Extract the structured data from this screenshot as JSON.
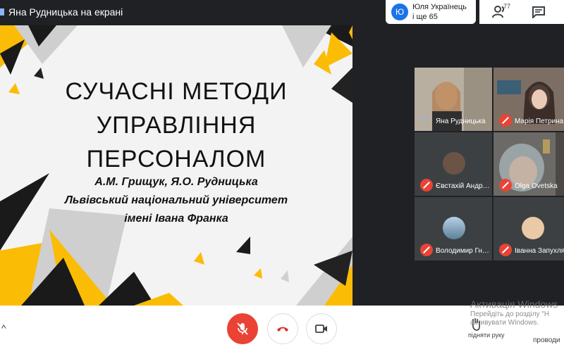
{
  "header": {
    "presenting_title": "Яна Рудницька на екрані",
    "presenter_chip": {
      "avatar_letter": "Ю",
      "line1": "Юля Українець",
      "line2": "і ще 65"
    },
    "people_count": "77",
    "icons": {
      "people": "people-icon",
      "chat": "chat-icon"
    }
  },
  "slide": {
    "title_lines": [
      "СУЧАСНІ МЕТОДИ",
      "УПРАВЛІННЯ",
      "ПЕРСОНАЛОМ"
    ],
    "authors": "А.М. Грищук, Я.О. Рудницька",
    "university_line1": "Львівський національний університет",
    "university_line2": "імені Івана Франка",
    "accent_color": "#fbbc05"
  },
  "participants": [
    {
      "name": "Яна Рудницька",
      "status": "speaking"
    },
    {
      "name": "Марія Петрина",
      "status": "muted"
    },
    {
      "name": "Євстахій Андрусишин",
      "status": "muted"
    },
    {
      "name": "Olga Ovetska",
      "status": "muted"
    },
    {
      "name": "Володимир Гнатів",
      "status": "muted"
    },
    {
      "name": "Іванна Запухляк",
      "status": "muted"
    }
  ],
  "controls": {
    "mic": "mic-off-icon",
    "hangup": "hangup-icon",
    "camera": "camera-icon",
    "raise_hand_label": "підняти руку",
    "present_label": "проводи"
  },
  "watermark": {
    "title": "Активація Windows",
    "line1": "Перейдіть до розділу \"Н",
    "line2": "активувати Windows."
  }
}
